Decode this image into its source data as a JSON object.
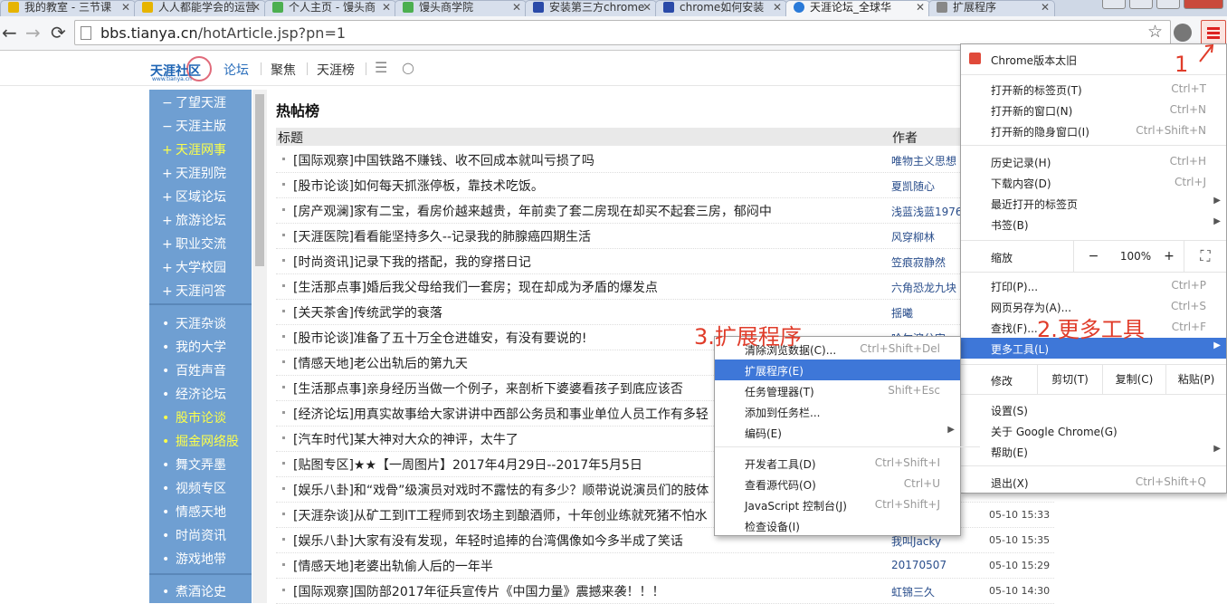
{
  "tabs": [
    {
      "title": "我的教室 - 三节课",
      "icon_color": "#e6b400"
    },
    {
      "title": "人人都能学会的运营",
      "icon_color": "#e6b400"
    },
    {
      "title": "个人主页 - 馒头商",
      "icon_color": "#4caf50"
    },
    {
      "title": "馒头商学院",
      "icon_color": "#4caf50"
    },
    {
      "title": "安装第三方chrome",
      "icon_color": "#2a4aa8"
    },
    {
      "title": "chrome如何安装",
      "icon_color": "#2a4aa8"
    },
    {
      "title": "天涯论坛_全球华",
      "icon_color": "#2a7ad8"
    },
    {
      "title": "扩展程序",
      "icon_color": "#888888"
    }
  ],
  "toolbar": {
    "back": "←",
    "forward": "→",
    "reload": "⟳",
    "url_host": "bbs.tianya.cn",
    "url_path": "/hotArticle.jsp?pn=1",
    "star": "☆"
  },
  "site": {
    "logo": "天涯社区",
    "logo_sub": "www.tianya.cn",
    "nav": [
      "论坛",
      "聚焦",
      "天涯榜"
    ],
    "nav_menu_icon": "☰",
    "nav_search_icon": "○"
  },
  "sidebar": [
    {
      "prefix": "−",
      "label": "了望天涯",
      "highlight": false
    },
    {
      "prefix": "−",
      "label": "天涯主版",
      "highlight": false
    },
    {
      "prefix": "+",
      "label": "天涯网事",
      "highlight": true
    },
    {
      "prefix": "+",
      "label": "天涯别院",
      "highlight": false
    },
    {
      "prefix": "+",
      "label": "区域论坛",
      "highlight": false
    },
    {
      "prefix": "+",
      "label": "旅游论坛",
      "highlight": false
    },
    {
      "prefix": "+",
      "label": "职业交流",
      "highlight": false
    },
    {
      "prefix": "+",
      "label": "大学校园",
      "highlight": false
    },
    {
      "prefix": "+",
      "label": "天涯问答",
      "highlight": false
    },
    {
      "prefix": "•",
      "label": "天涯杂谈",
      "highlight": false
    },
    {
      "prefix": "•",
      "label": "我的大学",
      "highlight": false
    },
    {
      "prefix": "•",
      "label": "百姓声音",
      "highlight": false
    },
    {
      "prefix": "•",
      "label": "经济论坛",
      "highlight": false
    },
    {
      "prefix": "•",
      "label": "股市论谈",
      "highlight": true
    },
    {
      "prefix": "•",
      "label": "掘金网络股",
      "highlight": true
    },
    {
      "prefix": "•",
      "label": "舞文弄墨",
      "highlight": false
    },
    {
      "prefix": "•",
      "label": "视频专区",
      "highlight": false
    },
    {
      "prefix": "•",
      "label": "情感天地",
      "highlight": false
    },
    {
      "prefix": "•",
      "label": "时尚资讯",
      "highlight": false
    },
    {
      "prefix": "•",
      "label": "游戏地带",
      "highlight": false
    },
    {
      "prefix": "•",
      "label": "煮酒论史",
      "highlight": false
    }
  ],
  "content": {
    "section_title": "热帖榜",
    "col_title": "标题",
    "col_author": "作者",
    "rows": [
      {
        "title": "[国际观察]中国铁路不赚钱、收不回成本就叫亏损了吗",
        "author": "唯物主义思想",
        "time": ""
      },
      {
        "title": "[股市论谈]如何每天抓涨停板，靠技术吃饭。",
        "author": "夏凯随心",
        "time": ""
      },
      {
        "title": "[房产观澜]家有二宝，看房价越来越贵，年前卖了套二房现在却买不起套三房，郁闷中",
        "author": "浅蓝浅蓝1976",
        "time": ""
      },
      {
        "title": "[天涯医院]看看能坚持多久--记录我的肺腺癌四期生活",
        "author": "风穿柳林",
        "time": ""
      },
      {
        "title": "[时尚资讯]记录下我的搭配，我的穿搭日记",
        "author": "笠痕寂静然",
        "time": ""
      },
      {
        "title": "[生活那点事]婚后我父母给我们一套房；现在却成为矛盾的爆发点",
        "author": "六角恐龙九块",
        "time": ""
      },
      {
        "title": "[关天茶舍]传统武学的衰落",
        "author": "揺曦",
        "time": ""
      },
      {
        "title": "[股市论谈]准备了五十万全仓进雄安，有没有要说的!",
        "author": "哈尔滨分宋",
        "time": ""
      },
      {
        "title": "[情感天地]老公出轨后的第九天",
        "author": "",
        "time": ""
      },
      {
        "title": "[生活那点事]亲身经历当做一个例子，来剖析下婆婆看孩子到底应该否",
        "author": "",
        "time": ""
      },
      {
        "title": "[经济论坛]用真实故事给大家讲讲中西部公务员和事业单位人员工作有多轻",
        "author": "",
        "time": ""
      },
      {
        "title": "[汽车时代]某大神对大众的神评，太牛了",
        "author": "",
        "time": ""
      },
      {
        "title": "[贴图专区]★★【一周图片】2017年4月29日--2017年5月5日",
        "author": "",
        "time": ""
      },
      {
        "title": "[娱乐八卦]和“戏骨”级演员对戏时不露怯的有多少？顺带说说演员们的肢体",
        "author": "",
        "time": ""
      },
      {
        "title": "[天涯杂谈]从矿工到IT工程师到农场主到酿酒师，十年创业练就死猪不怕水",
        "author": "",
        "time": "05-10 15:33"
      },
      {
        "title": "[娱乐八卦]大家有没有发现，年轻时追捧的台湾偶像如今多半成了笑话",
        "author": "我叫Jacky",
        "time": "05-10 15:35"
      },
      {
        "title": "[情感天地]老婆出轨偷人后的一年半",
        "author": "20170507",
        "time": "05-10 15:29"
      },
      {
        "title": "[国际观察]国防部2017年征兵宣传片《中国力量》震撼来袭！！！",
        "author": "虹锦三久",
        "time": "05-10 14:30"
      }
    ]
  },
  "chrome_menu": {
    "update": "Chrome版本太旧",
    "new_tab": {
      "label": "打开新的标签页(T)",
      "shortcut": "Ctrl+T"
    },
    "new_window": {
      "label": "打开新的窗口(N)",
      "shortcut": "Ctrl+N"
    },
    "incognito": {
      "label": "打开新的隐身窗口(I)",
      "shortcut": "Ctrl+Shift+N"
    },
    "history": {
      "label": "历史记录(H)",
      "shortcut": "Ctrl+H"
    },
    "downloads": {
      "label": "下载内容(D)",
      "shortcut": "Ctrl+J"
    },
    "recent_tabs": {
      "label": "最近打开的标签页"
    },
    "bookmarks": {
      "label": "书签(B)"
    },
    "zoom": {
      "label": "缩放",
      "minus": "−",
      "value": "100%",
      "plus": "+",
      "fullscreen": "⛶"
    },
    "print": {
      "label": "打印(P)...",
      "shortcut": "Ctrl+P"
    },
    "save_as": {
      "label": "网页另存为(A)...",
      "shortcut": "Ctrl+S"
    },
    "find": {
      "label": "查找(F)...",
      "shortcut": "Ctrl+F"
    },
    "more_tools": {
      "label": "更多工具(L)"
    },
    "edit": {
      "label": "修改",
      "cut": "剪切(T)",
      "copy": "复制(C)",
      "paste": "粘贴(P)"
    },
    "settings": {
      "label": "设置(S)"
    },
    "about": {
      "label": "关于 Google Chrome(G)"
    },
    "help": {
      "label": "帮助(E)"
    },
    "exit": {
      "label": "退出(X)",
      "shortcut": "Ctrl+Shift+Q"
    }
  },
  "submenu": {
    "clear_data": {
      "label": "清除浏览数据(C)...",
      "shortcut": "Ctrl+Shift+Del"
    },
    "extensions": {
      "label": "扩展程序(E)"
    },
    "task_manager": {
      "label": "任务管理器(T)",
      "shortcut": "Shift+Esc"
    },
    "add_to_taskbar": {
      "label": "添加到任务栏..."
    },
    "encoding": {
      "label": "编码(E)"
    },
    "devtools": {
      "label": "开发者工具(D)",
      "shortcut": "Ctrl+Shift+I"
    },
    "view_source": {
      "label": "查看源代码(O)",
      "shortcut": "Ctrl+U"
    },
    "js_console": {
      "label": "JavaScript 控制台(J)",
      "shortcut": "Ctrl+Shift+J"
    },
    "inspect": {
      "label": "检查设备(I)"
    }
  },
  "annotations": {
    "step1": "1",
    "step2": "2.更多工具",
    "step3": "3.扩展程序"
  },
  "colors": {
    "sidebar_bg": "#6f9fd2",
    "menu_highlight": "#3e77d8",
    "annotation": "#e03c2a"
  }
}
